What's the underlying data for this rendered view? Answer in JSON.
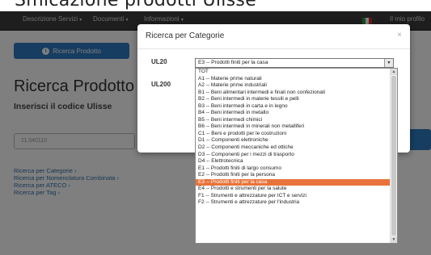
{
  "page": {
    "heading_partial": "Smicazione prodotti Ulisse",
    "nav": {
      "items": [
        {
          "label": "Descrizione Servizi"
        },
        {
          "label": "Documenti"
        },
        {
          "label": "Informazioni"
        }
      ],
      "user": "Il mio profilo"
    },
    "tab_label": "Ricerca Prodotto",
    "title": "Ricerca Prodotto",
    "subtitle": "Inserisci il codice Ulisse",
    "input_placeholder": "11.540110",
    "links": [
      "Ricerca per Categorie",
      "Ricerca per Nomenclatura Combinata",
      "Ricerca per ATECO",
      "Ricerca per Tag"
    ]
  },
  "modal": {
    "title": "Ricerca per Categorie",
    "close": "×",
    "label_ul20": "UL20",
    "label_ul200": "UL200",
    "selected_value": "E3 -- Prodotti finiti per la casa",
    "options": [
      "TOT",
      "A1 -- Materie prime naturali",
      "A2 -- Materie prime industriali",
      "B1 -- Beni alimentari intermedi e finali non confezionati",
      "B2 -- Beni intermedi in materie tessili e pelli",
      "B3 -- Beni intermedi in carta e in legno",
      "B4 -- Beni intermedi in metallo",
      "B5 -- Beni intermedi chimici",
      "B6 -- Beni intermedi in minerali non metalliferi",
      "C1 -- Beni e prodotti per le costruzioni",
      "D1 -- Componenti elettroniche",
      "D2 -- Componenti meccaniche ed ottiche",
      "D3 -- Componenti per i mezzi di trasporto",
      "D4 -- Elettrotecnica",
      "E1 -- Prodotti finiti di largo consumo",
      "E2 -- Prodotti finiti per la persona",
      "E3 -- Prodotti finiti per la casa",
      "E4 -- Prodotti e strumenti per la salute",
      "F1 -- Strumenti e attrezzature per ICT e servizi",
      "F2 -- Strumenti e attrezzature per l'industria"
    ],
    "selected_index": 16
  },
  "colors": {
    "selected_option": "#e8743b",
    "primary": "#2f7bc2"
  }
}
